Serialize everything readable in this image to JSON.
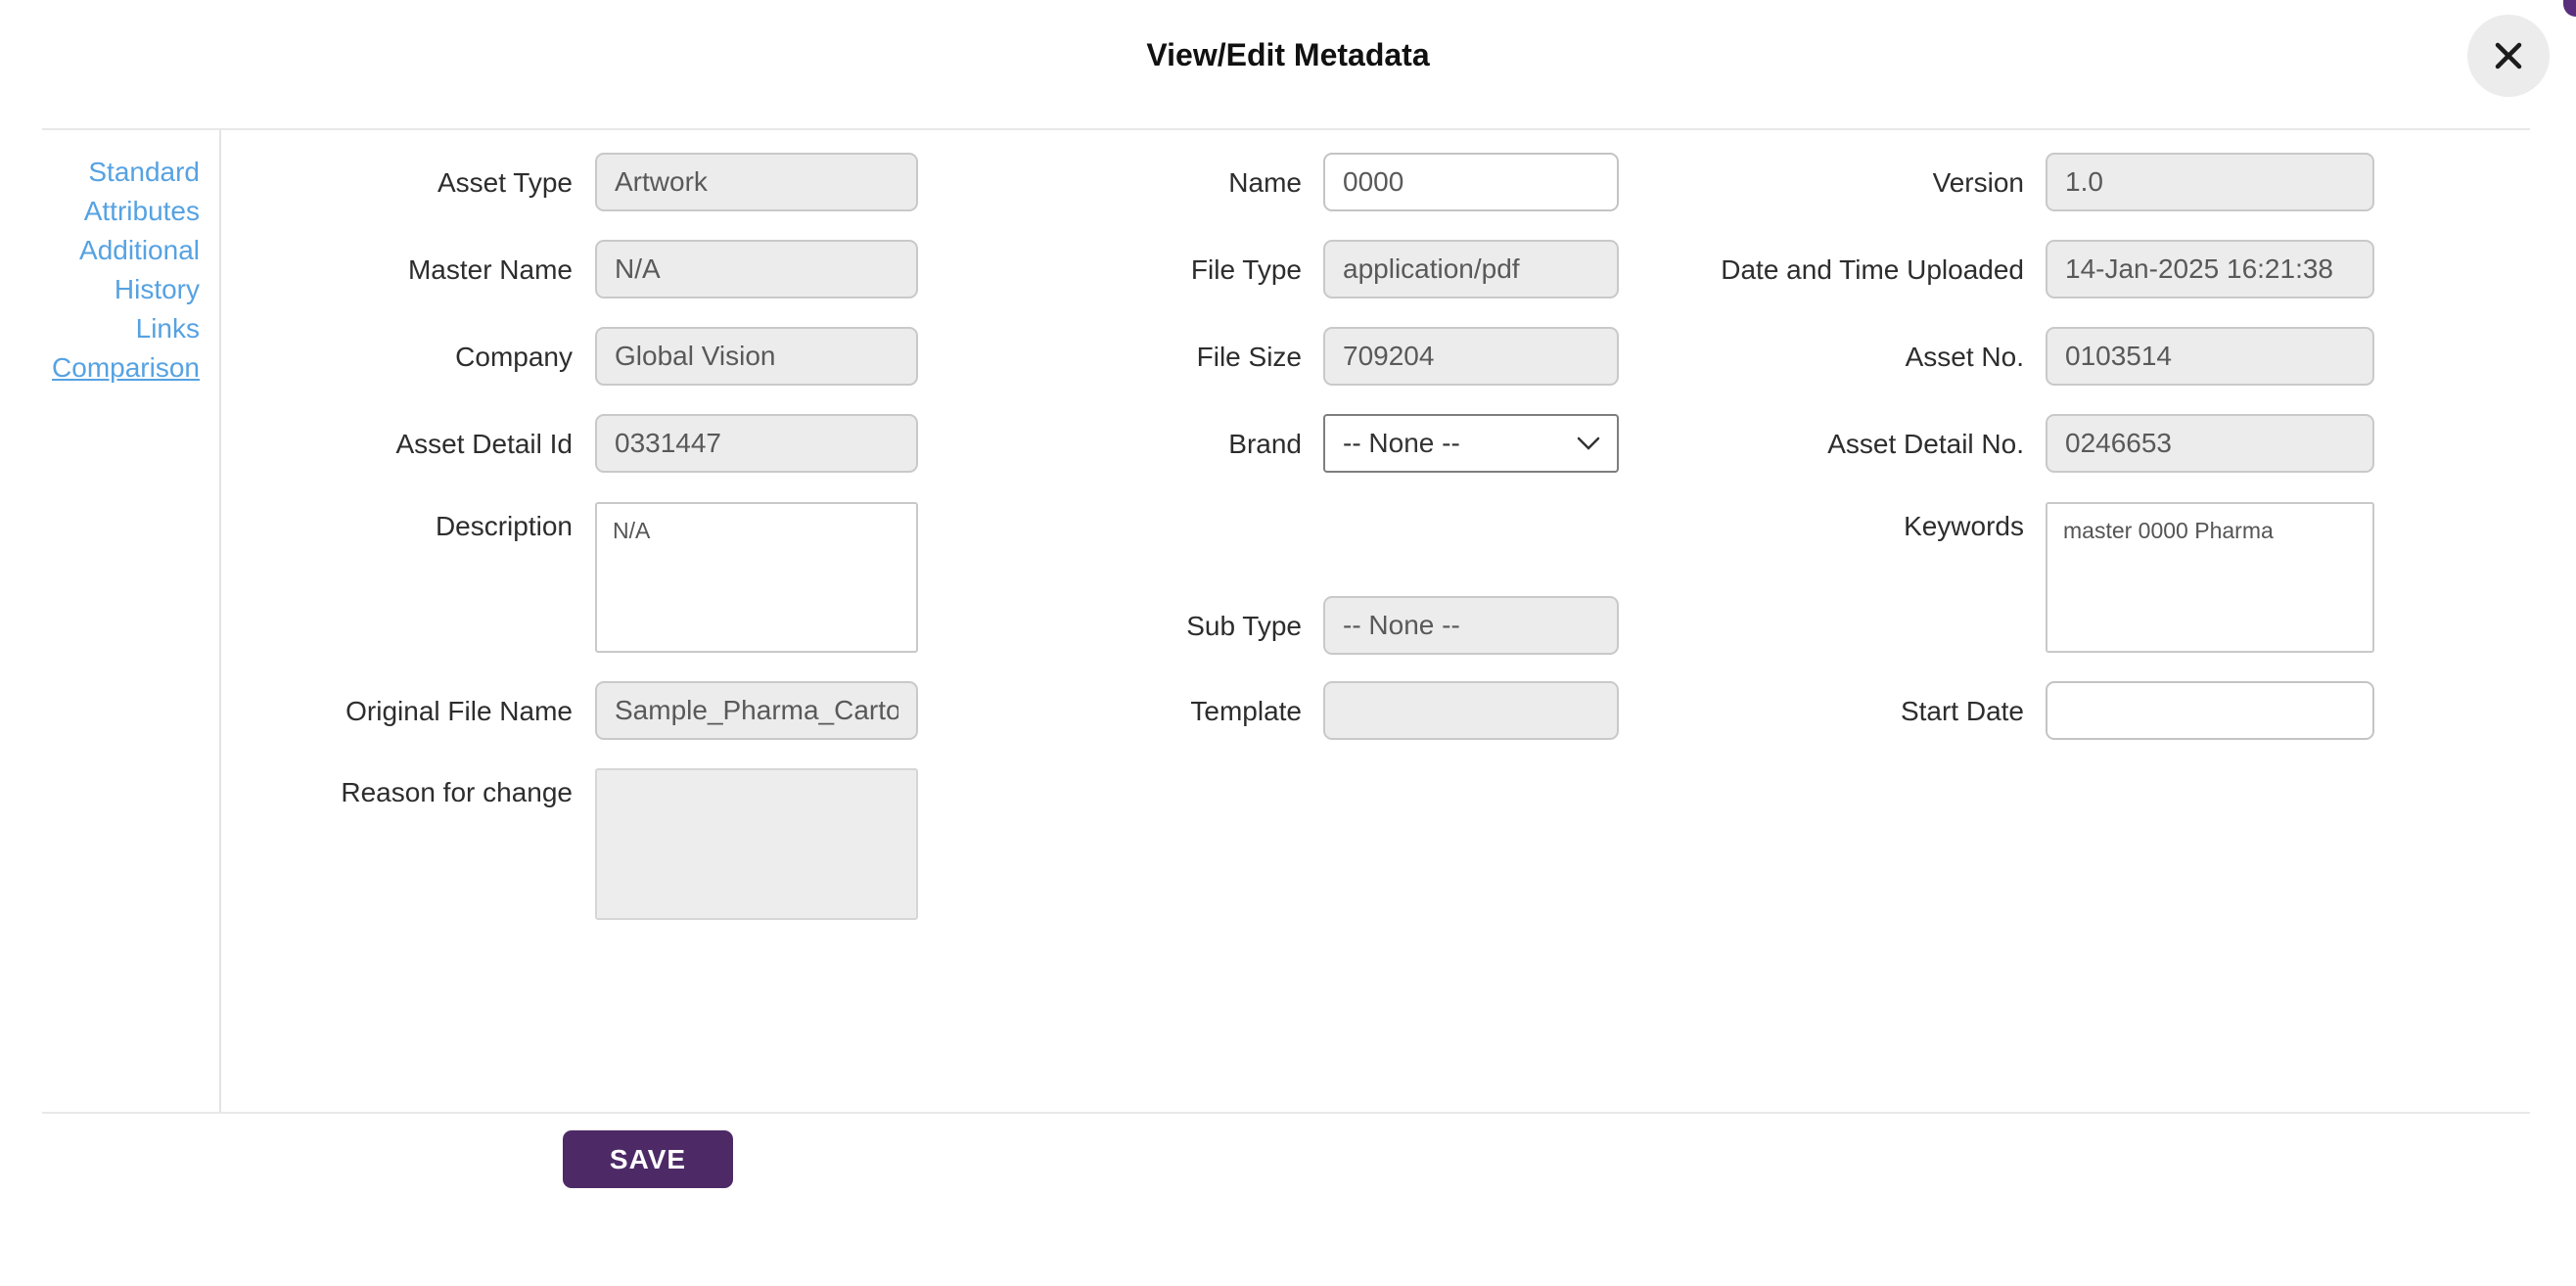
{
  "modal": {
    "title": "View/Edit Metadata"
  },
  "sidebar": {
    "items": [
      {
        "label": "Standard"
      },
      {
        "label": "Attributes"
      },
      {
        "label": "Additional"
      },
      {
        "label": "History"
      },
      {
        "label": "Links"
      },
      {
        "label": "Comparison",
        "underlined": true
      }
    ]
  },
  "form": {
    "col1": [
      {
        "label": "Asset Type",
        "value": "Artwork"
      },
      {
        "label": "Master Name",
        "value": "N/A"
      },
      {
        "label": "Company",
        "value": "Global Vision"
      },
      {
        "label": "Asset Detail Id",
        "value": "0331447"
      },
      {
        "label": "Description",
        "value": "N/A"
      },
      {
        "label": "Original File Name",
        "value": "Sample_Pharma_Cartor"
      },
      {
        "label": "Reason for change",
        "value": ""
      }
    ],
    "col2": [
      {
        "label": "Name",
        "value": "0000"
      },
      {
        "label": "File Type",
        "value": "application/pdf"
      },
      {
        "label": "File Size",
        "value": "709204"
      },
      {
        "label": "Brand",
        "value": "-- None --"
      },
      {
        "label": "Sub Type",
        "value": "-- None --"
      },
      {
        "label": "Template",
        "value": ""
      }
    ],
    "col3": [
      {
        "label": "Version",
        "value": "1.0"
      },
      {
        "label": "Date and Time Uploaded",
        "value": "14-Jan-2025 16:21:38"
      },
      {
        "label": "Asset No.",
        "value": "0103514"
      },
      {
        "label": "Asset Detail No.",
        "value": "0246653"
      },
      {
        "label": "Keywords",
        "value": "master 0000 Pharma"
      },
      {
        "label": "Start Date",
        "value": ""
      }
    ]
  },
  "footer": {
    "save_label": "SAVE"
  },
  "colors": {
    "accent_purple": "#4d2a66",
    "link_blue": "#56a2e2",
    "input_gray": "#ececec",
    "divider_gray": "#e8e8e8"
  }
}
